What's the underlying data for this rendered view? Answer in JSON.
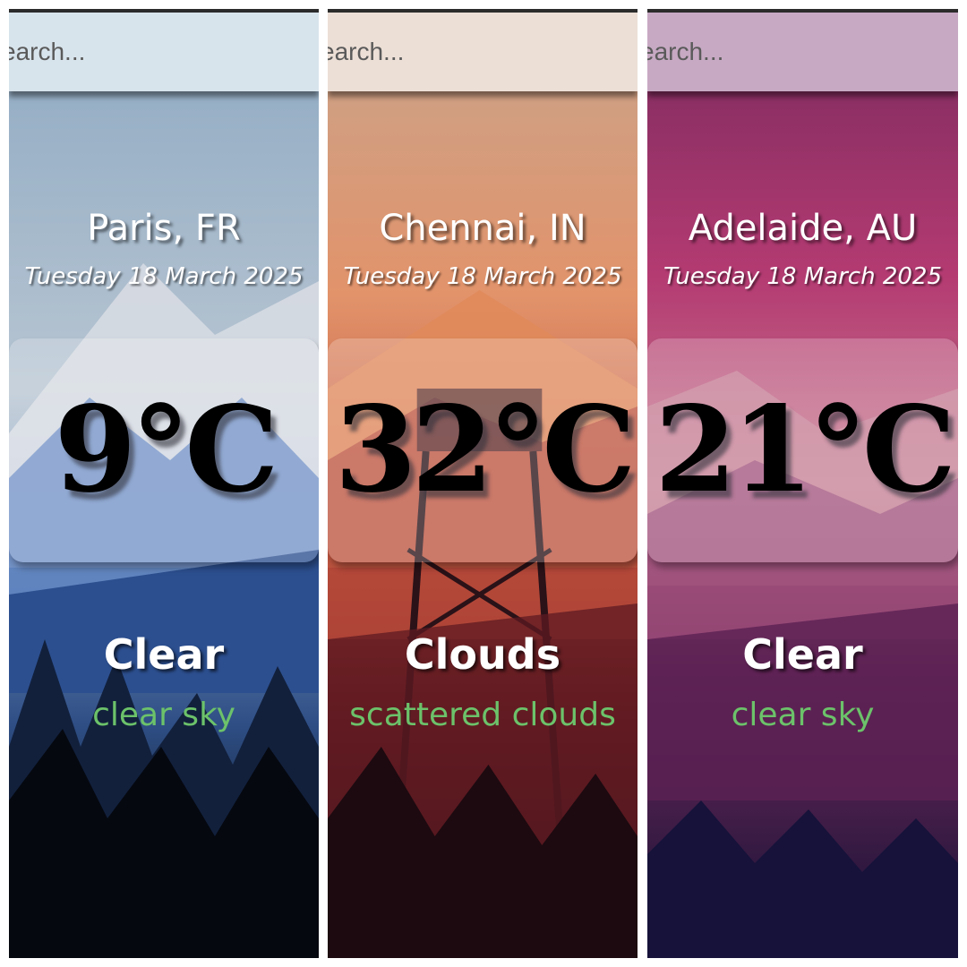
{
  "panels": [
    {
      "search_placeholder": "earch...",
      "location": "Paris, FR",
      "date": "Tuesday 18 March 2025",
      "temperature": "9°C",
      "condition": "Clear",
      "description": "clear sky"
    },
    {
      "search_placeholder": "earch...",
      "location": "Chennai, IN",
      "date": "Tuesday 18 March 2025",
      "temperature": "32°C",
      "condition": "Clouds",
      "description": "scattered clouds"
    },
    {
      "search_placeholder": "earch...",
      "location": "Adelaide, AU",
      "date": "Tuesday 18 March 2025",
      "temperature": "21°C",
      "condition": "Clear",
      "description": "clear sky"
    }
  ],
  "colors": {
    "description_text": "#6cc26a",
    "temperature_text": "#000000",
    "heading_text": "#ffffff"
  }
}
